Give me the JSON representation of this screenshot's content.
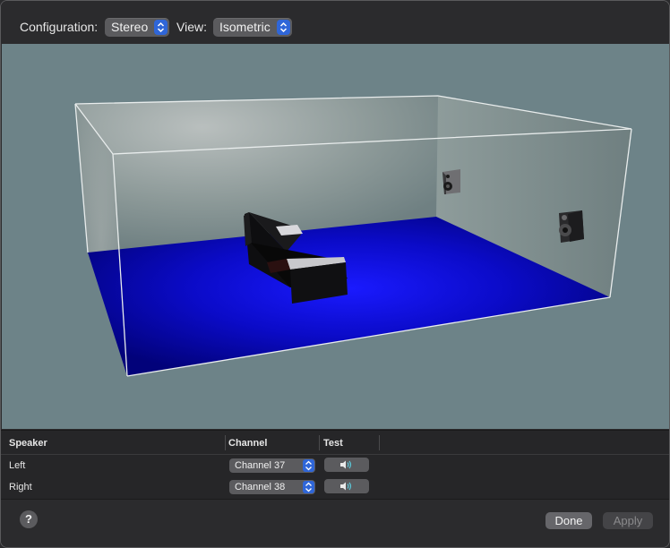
{
  "config": {
    "configuration_label": "Configuration:",
    "configuration_value": "Stereo",
    "view_label": "View:",
    "view_value": "Isometric"
  },
  "viewport": {
    "background": "#6d8388",
    "floor_color": "#0a0ad0",
    "objects": [
      "sofa",
      "speaker-left",
      "speaker-right"
    ]
  },
  "table": {
    "headers": {
      "speaker": "Speaker",
      "channel": "Channel",
      "test": "Test"
    },
    "rows": [
      {
        "speaker": "Left",
        "channel": "Channel 37",
        "test_icon": "speaker-sound-icon"
      },
      {
        "speaker": "Right",
        "channel": "Channel 38",
        "test_icon": "speaker-sound-icon"
      }
    ]
  },
  "footer": {
    "help_label": "?",
    "done_label": "Done",
    "apply_label": "Apply"
  },
  "colors": {
    "accent": "#2f66d8"
  }
}
